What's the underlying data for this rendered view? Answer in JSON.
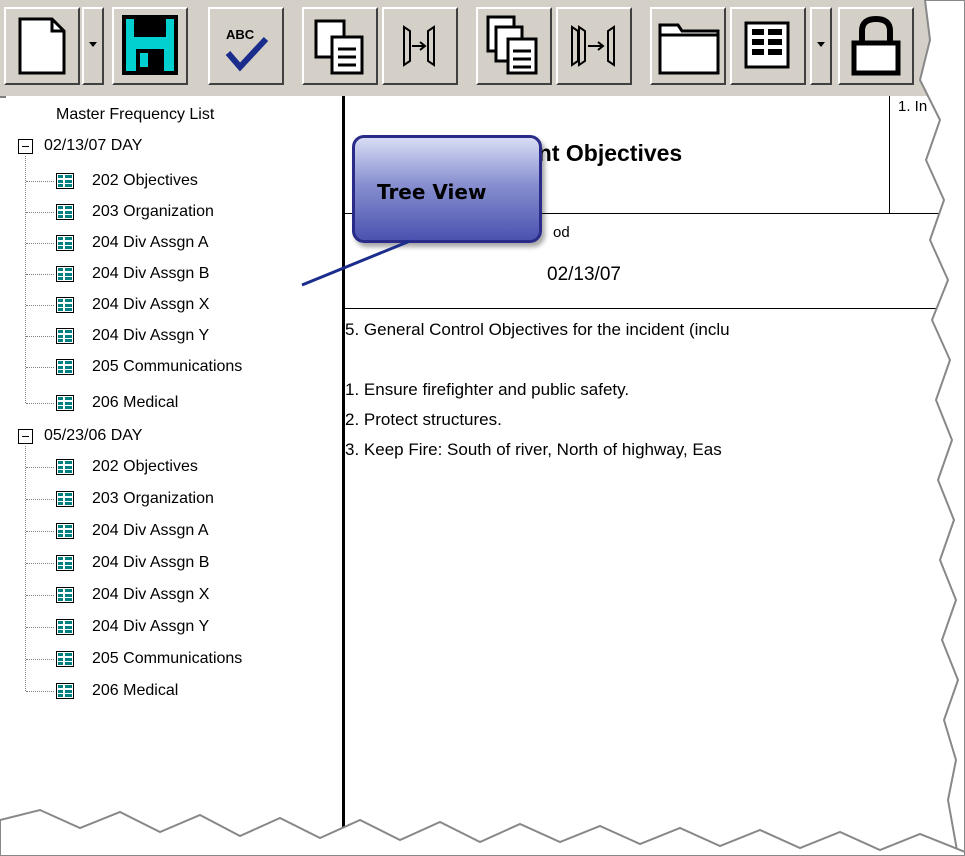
{
  "toolbar": {
    "buttons": [
      {
        "name": "new-document-button",
        "icon": "new-page-icon"
      },
      {
        "name": "save-button",
        "icon": "floppy-disk-icon"
      },
      {
        "name": "spell-check-button",
        "icon": "spell-check-icon",
        "label": "ABC"
      },
      {
        "name": "copy-button",
        "icon": "copy-document-icon"
      },
      {
        "name": "merge-columns-button",
        "icon": "merge-arrows-icon"
      },
      {
        "name": "copy-all-button",
        "icon": "copy-multiple-icon"
      },
      {
        "name": "merge-all-button",
        "icon": "merge-multiple-icon"
      },
      {
        "name": "folder-tab-button",
        "icon": "folder-tab-icon"
      },
      {
        "name": "form-grid-button",
        "icon": "form-grid-icon"
      },
      {
        "name": "lock-button",
        "icon": "lock-icon"
      }
    ]
  },
  "tree": {
    "title": "Master Frequency List",
    "groups": [
      {
        "label": "02/13/07 DAY",
        "items": [
          "202 Objectives",
          "203 Organization",
          "204 Div Assgn  A",
          "204 Div Assgn  B",
          "204 Div Assgn  X",
          "204 Div Assgn  Y",
          "205 Communications",
          "206 Medical"
        ]
      },
      {
        "label": "05/23/06 DAY",
        "items": [
          "202 Objectives",
          "203 Organization",
          "204 Div Assgn  A",
          "204 Div Assgn  B",
          "204 Div Assgn  X",
          "204 Div Assgn  Y",
          "205 Communications",
          "206 Medical"
        ]
      }
    ]
  },
  "callout": {
    "text": "Tree View"
  },
  "document": {
    "title": "ent Objectives",
    "box1_label": "1. In",
    "period_label": "od",
    "period_value": "02/13/07",
    "general_objectives": "5. General Control Objectives for the incident (inclu",
    "objectives": [
      "1.  Ensure firefighter and public safety.",
      "2.  Protect structures.",
      "3.  Keep Fire:  South of river, North of highway, Eas"
    ]
  },
  "colors": {
    "toolbar_bg": "#d4d0c8",
    "save_icon": "#00d0d0",
    "form_icon": "#008080",
    "callout_fill": "#5a60c0"
  }
}
